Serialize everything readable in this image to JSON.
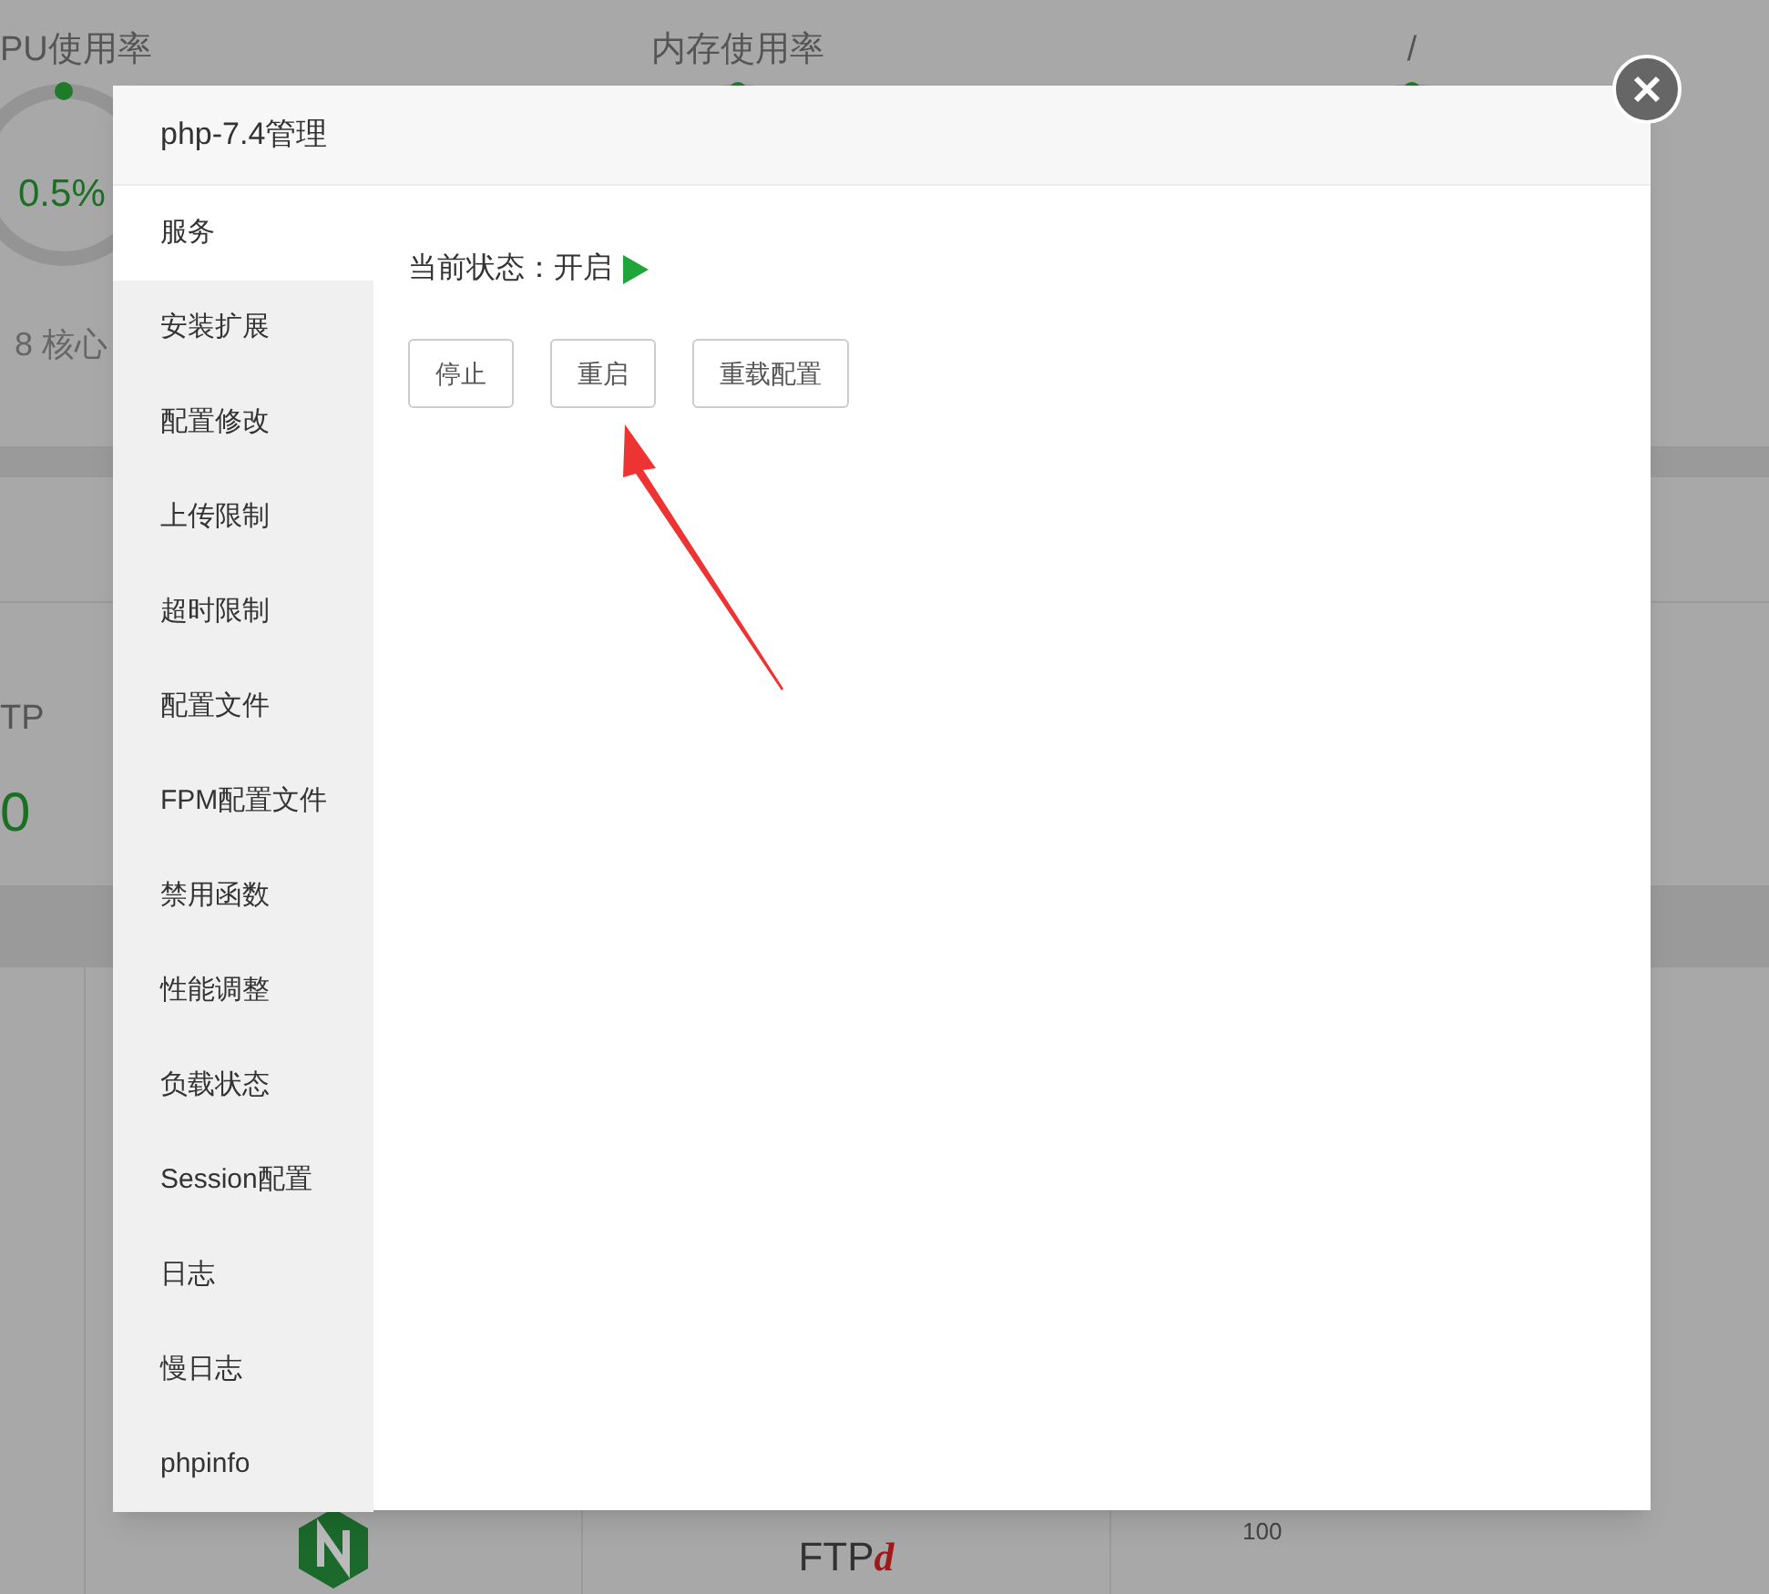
{
  "dashboard": {
    "cpu": {
      "title": "PU使用率",
      "value": "0.5%",
      "detail": "8 核心"
    },
    "memory": {
      "title": "内存使用率"
    },
    "disk": {
      "title": "/"
    },
    "ftp": {
      "title": "TP",
      "count": "0"
    },
    "chart_label": "100",
    "ftp_logo": {
      "main": "FTP",
      "suffix": "d"
    }
  },
  "dialog": {
    "title": "php-7.4管理",
    "nav": [
      {
        "label": "服务",
        "selected": true
      },
      {
        "label": "安装扩展",
        "selected": false
      },
      {
        "label": "配置修改",
        "selected": false
      },
      {
        "label": "上传限制",
        "selected": false
      },
      {
        "label": "超时限制",
        "selected": false
      },
      {
        "label": "配置文件",
        "selected": false
      },
      {
        "label": "FPM配置文件",
        "selected": false
      },
      {
        "label": "禁用函数",
        "selected": false
      },
      {
        "label": "性能调整",
        "selected": false
      },
      {
        "label": "负载状态",
        "selected": false
      },
      {
        "label": "Session配置",
        "selected": false
      },
      {
        "label": "日志",
        "selected": false
      },
      {
        "label": "慢日志",
        "selected": false
      },
      {
        "label": "phpinfo",
        "selected": false
      }
    ],
    "status": {
      "label": "当前状态：",
      "value": "开启",
      "running": true
    },
    "buttons": [
      "停止",
      "重启",
      "重载配置"
    ]
  }
}
